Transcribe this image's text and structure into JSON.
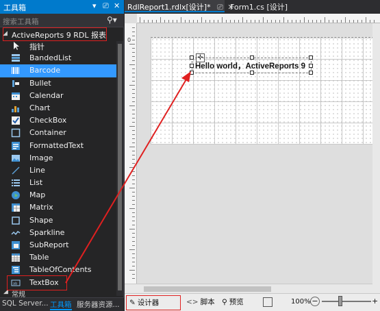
{
  "toolbox": {
    "title": "工具箱",
    "title_controls": [
      "▾",
      "📌",
      "✕"
    ],
    "search_placeholder": "搜索工具箱",
    "group_label": "ActiveReports 9 RDL 报表",
    "items": [
      {
        "label": "指针",
        "icon": "pointer-icon"
      },
      {
        "label": "BandedList",
        "icon": "banded-list-icon"
      },
      {
        "label": "Barcode",
        "icon": "barcode-icon"
      },
      {
        "label": "Bullet",
        "icon": "bullet-icon"
      },
      {
        "label": "Calendar",
        "icon": "calendar-icon"
      },
      {
        "label": "Chart",
        "icon": "chart-icon"
      },
      {
        "label": "CheckBox",
        "icon": "checkbox-icon"
      },
      {
        "label": "Container",
        "icon": "container-icon"
      },
      {
        "label": "FormattedText",
        "icon": "formatted-text-icon"
      },
      {
        "label": "Image",
        "icon": "image-icon"
      },
      {
        "label": "Line",
        "icon": "line-icon"
      },
      {
        "label": "List",
        "icon": "list-icon"
      },
      {
        "label": "Map",
        "icon": "map-icon"
      },
      {
        "label": "Matrix",
        "icon": "matrix-icon"
      },
      {
        "label": "Shape",
        "icon": "shape-icon"
      },
      {
        "label": "Sparkline",
        "icon": "sparkline-icon"
      },
      {
        "label": "SubReport",
        "icon": "subreport-icon"
      },
      {
        "label": "Table",
        "icon": "table-icon"
      },
      {
        "label": "TableOfContents",
        "icon": "table-of-contents-icon"
      },
      {
        "label": "TextBox",
        "icon": "textbox-icon"
      }
    ],
    "selected_item": "Barcode",
    "general_group": "常规",
    "bottom_tabs": [
      "SQL Server...",
      "工具箱",
      "服务器资源..."
    ],
    "active_bottom_tab": "工具箱"
  },
  "document": {
    "tabs": [
      {
        "label": "RdlReport1.rdlx[设计]*",
        "active": true
      },
      {
        "label": "Form1.cs [设计]",
        "active": false
      }
    ],
    "ruler_zero": "0",
    "textbox_text": "Hello world，ActiveReports 9"
  },
  "bottom_bar": {
    "designer_label": "设计器",
    "script_label": "脚本",
    "preview_label": "预览",
    "zoom": "100%",
    "zoom_minus": "−",
    "zoom_plus": "+"
  },
  "colors": {
    "accent": "#007acc",
    "selection": "#3399ff",
    "annotation_red": "#e02020"
  }
}
